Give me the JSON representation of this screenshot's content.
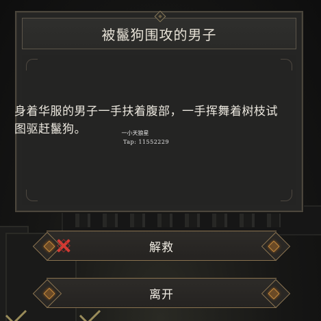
{
  "dialog": {
    "title": "被鬣狗围攻的男子",
    "body_text": "身着华服的男子一手扶着腹部，一手挥舞着树枝试图驱赶鬣狗。"
  },
  "watermark": {
    "name": "一小天狼星",
    "tap": "Tap: 11552229"
  },
  "choices": [
    {
      "label": "解救",
      "locked": true,
      "lock_icon": "red-x-icon"
    },
    {
      "label": "离开",
      "locked": false
    }
  ],
  "colors": {
    "panel_bg": "#252524",
    "border_gold": "#8a7350",
    "text": "#ece8df",
    "locked_red": "#d23a33",
    "gem_orange": "#c28a3e"
  }
}
